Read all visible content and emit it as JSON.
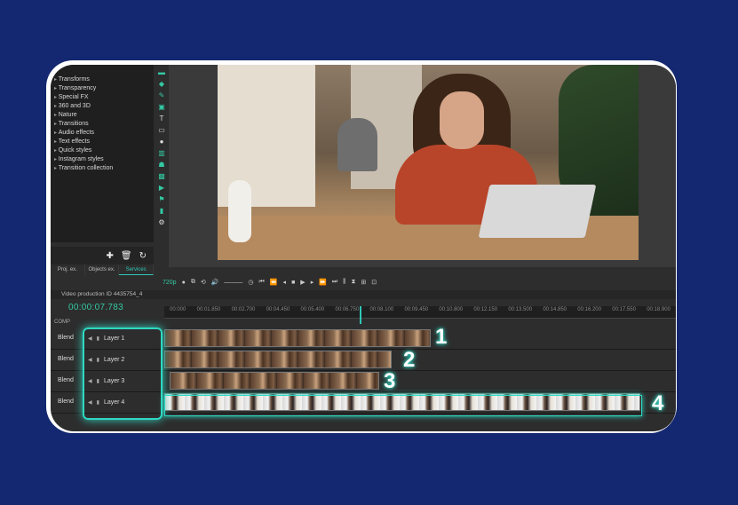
{
  "effects_panel": {
    "items": [
      "Transforms",
      "Transparency",
      "Special FX",
      "360 and 3D",
      "Nature",
      "Transitions",
      "Audio effects",
      "Text effects",
      "Quick styles",
      "Instagram styles",
      "Transition collection"
    ],
    "tabs": [
      "Proj. ex.",
      "Objects ex.",
      "Services"
    ]
  },
  "transport": {
    "resolution": "720p"
  },
  "info": {
    "file_label": "Video production ID 4435754_4"
  },
  "timecode": "00:00:07.783",
  "comp_label": "COMP",
  "ruler_ticks": [
    "00:000",
    "00:01.850",
    "00:02.700",
    "00:04.450",
    "00:05.400",
    "00:06.750",
    "00:08.100",
    "00:09.450",
    "00:10.800",
    "00:12.150",
    "00:13.500",
    "00:14.850",
    "00:16.200",
    "00:17.550",
    "00:18.900"
  ],
  "tracks": [
    {
      "blend": "Blend",
      "layer": "Layer 1",
      "number": "1"
    },
    {
      "blend": "Blend",
      "layer": "Layer 2",
      "number": "2"
    },
    {
      "blend": "Blend",
      "layer": "Layer 3",
      "number": "3"
    },
    {
      "blend": "Blend",
      "layer": "Layer 4",
      "number": "4"
    }
  ],
  "accent_color": "#2fd8c2",
  "background_color": "#132870"
}
